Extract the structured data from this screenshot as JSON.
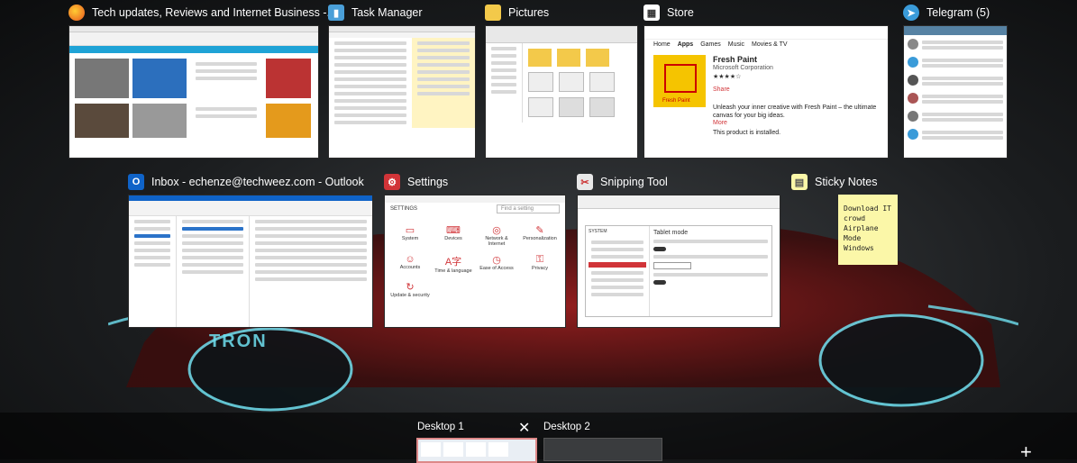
{
  "windows_row1": [
    {
      "title": "Tech updates, Reviews and Internet Business -...",
      "icon": "firefox-icon"
    },
    {
      "title": "Task Manager",
      "icon": "task-manager-icon"
    },
    {
      "title": "Pictures",
      "icon": "folder-icon"
    },
    {
      "title": "Store",
      "icon": "store-icon"
    },
    {
      "title": "Telegram (5)",
      "icon": "telegram-icon"
    }
  ],
  "windows_row2": [
    {
      "title": "Inbox - echenze@techweez.com - Outlook",
      "icon": "outlook-icon"
    },
    {
      "title": "Settings",
      "icon": "settings-icon"
    },
    {
      "title": "Snipping Tool",
      "icon": "snipping-tool-icon"
    },
    {
      "title": "Sticky Notes",
      "icon": "sticky-notes-icon"
    }
  ],
  "store_thumb": {
    "tabs": [
      "Home",
      "Apps",
      "Games",
      "Music",
      "Movies & TV"
    ],
    "app_name": "Fresh Paint",
    "publisher": "Microsoft Corporation",
    "description": "Unleash your inner creative with Fresh Paint – the ultimate canvas for your big ideas.",
    "more": "More",
    "share": "Share",
    "installed": "This product is installed.",
    "logo_text": "Fresh Paint"
  },
  "settings_thumb": {
    "header": "SETTINGS",
    "search_placeholder": "Find a setting",
    "items": [
      "System",
      "Devices",
      "Network & Internet",
      "Personalization",
      "Accounts",
      "Time & language",
      "Ease of Access",
      "Privacy",
      "Update & security"
    ]
  },
  "snipping_thumb": {
    "header": "SYSTEM",
    "page_title": "Tablet mode"
  },
  "sticky_note": {
    "text": "Download IT crowd Airplane Mode Windows"
  },
  "desktops": [
    {
      "label": "Desktop 1"
    },
    {
      "label": "Desktop 2"
    }
  ],
  "controls": {
    "close_glyph": "✕",
    "new_desktop_glyph": "+"
  },
  "wallpaper": {
    "logo_text": "TRON"
  },
  "colors": {
    "accent_red": "#d13438",
    "tron_cyan": "#6fe0f0",
    "store_yellow": "#f5c400",
    "telegram_blue": "#3a9bd9",
    "outlook_blue": "#0f63c8"
  }
}
